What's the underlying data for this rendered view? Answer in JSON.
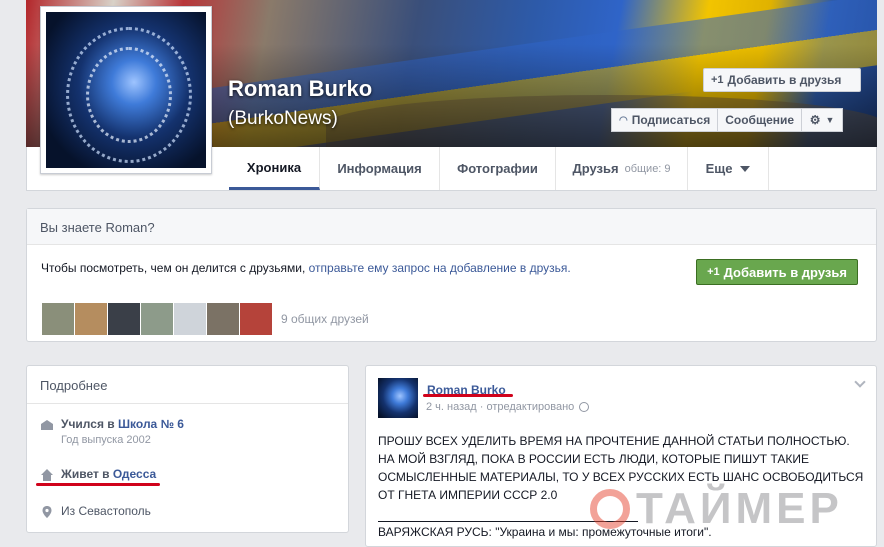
{
  "profile": {
    "name": "Roman Burko",
    "subname": "(BurkoNews)",
    "add_friend_label": "Добавить в друзья",
    "subscribe_label": "Подписаться",
    "message_label": "Сообщение"
  },
  "tabs": [
    {
      "label": "Хроника",
      "active": true
    },
    {
      "label": "Информация"
    },
    {
      "label": "Фотографии"
    },
    {
      "label": "Друзья",
      "sub": "общие: 9"
    },
    {
      "label": "Еще"
    }
  ],
  "know": {
    "title": "Вы знаете Roman?",
    "text_prefix": "Чтобы посмотреть, чем он делится с друзьями, ",
    "text_link": "отправьте ему запрос на добавление в друзья.",
    "add_friend_label": "Добавить в друзья",
    "mutual_label": "9 общих друзей"
  },
  "details": {
    "title": "Подробнее",
    "study_prefix": "Учился в ",
    "study_school": "Школа № 6",
    "study_year": "Год выпуска 2002",
    "lives_prefix": "Живет в ",
    "lives_city": "Одесса",
    "from_label": "Из Севастополь"
  },
  "post": {
    "author": "Roman Burko",
    "meta": "2 ч. назад · отредактировано",
    "body": "ПРОШУ ВСЕХ УДЕЛИТЬ ВРЕМЯ НА ПРОЧТЕНИЕ ДАННОЙ СТАТЬИ ПОЛНОСТЬЮ. НА МОЙ ВЗГЛЯД, ПОКА В РОССИИ ЕСТЬ ЛЮДИ, КОТОРЫЕ ПИШУТ ТАКИЕ ОСМЫСЛЕННЫЕ МАТЕРИАЛЫ, ТО У ВСЕХ РУССКИХ ЕСТЬ ШАНС ОСВОБОДИТЬСЯ ОТ ГНЕТА ИМПЕРИИ СССР 2.0",
    "link_text": "ВАРЯЖСКАЯ РУСЬ: \"Украина и мы: промежуточные итоги\"."
  },
  "watermark": "ТАЙМЕР",
  "colors": {
    "link": "#3b5998",
    "green": "#69a74e",
    "highlight": "#d0021b"
  }
}
